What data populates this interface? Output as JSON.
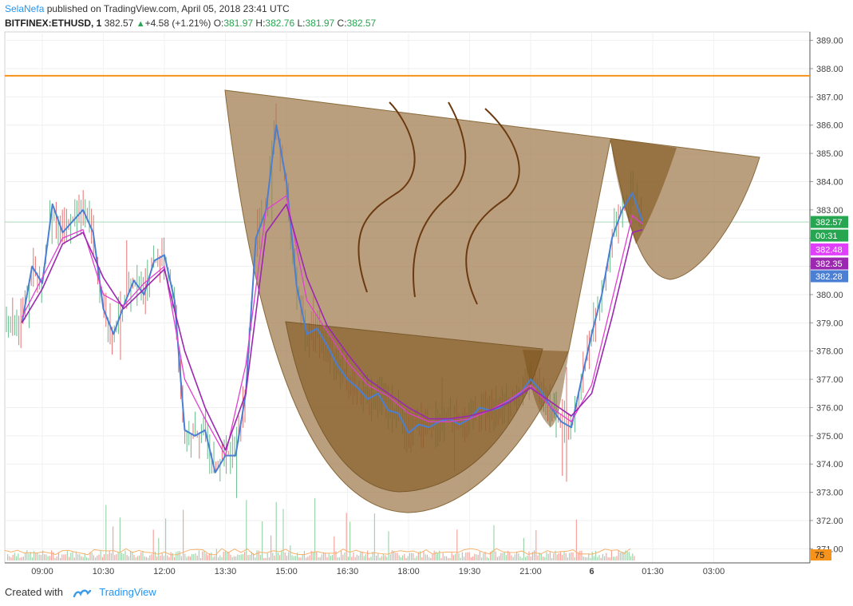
{
  "header": {
    "author": "SelaNefa",
    "published_text": "published on TradingView.com, April 05, 2018 23:41 UTC",
    "symbol": "BITFINEX:ETHUSD, 1",
    "last_price": "382.57",
    "change": "+4.58 (+1.21%)",
    "open_label": "O:",
    "open": "381.97",
    "high_label": "H:",
    "high": "382.76",
    "low_label": "L:",
    "low": "381.97",
    "close_label": "C:",
    "close": "382.57"
  },
  "footer": {
    "created_with": "Created with",
    "brand": "TradingView"
  },
  "colors": {
    "up": "#26a650",
    "down": "#ef5350",
    "cup_fill": "#a07a4e",
    "cup_dark": "#7a4e14",
    "orange_line": "#f7931a",
    "ema_blue": "#4a7fd4",
    "ema_magenta": "#e040d0",
    "ema_purple": "#9c27b0",
    "steam": "#6b3a10"
  },
  "chart_data": {
    "type": "line",
    "ylim": [
      370.5,
      389.3
    ],
    "y_ticks": [
      "389.00",
      "388.00",
      "387.00",
      "386.00",
      "385.00",
      "384.00",
      "383.00",
      "382.00",
      "381.00",
      "380.00",
      "379.00",
      "378.00",
      "377.00",
      "376.00",
      "375.00",
      "374.00",
      "373.00",
      "372.00",
      "371.00"
    ],
    "x_ticks": [
      "09:00",
      "10:30",
      "12:00",
      "13:30",
      "15:00",
      "16:30",
      "18:00",
      "19:30",
      "21:00",
      "6",
      "01:30",
      "03:00"
    ],
    "price_labels": [
      {
        "text": "382.57",
        "value": 382.57,
        "color": "#26a650"
      },
      {
        "text": "00:31",
        "value": 382.09,
        "color": "#26a650"
      },
      {
        "text": "382.48",
        "value": 381.6,
        "color": "#e040fb"
      },
      {
        "text": "382.35",
        "value": 381.1,
        "color": "#9c27b0"
      },
      {
        "text": "382.28",
        "value": 380.65,
        "color": "#4a7fd4"
      }
    ],
    "volume_label": {
      "text": "75",
      "color": "#f7931a"
    },
    "resistance_level": 387.75,
    "series": [
      {
        "x": [
          "08:30",
          "08:45",
          "09:00",
          "09:15",
          "09:30",
          "09:45",
          "10:00",
          "10:15",
          "10:30",
          "10:45",
          "11:00",
          "11:15",
          "11:30",
          "11:45",
          "12:00",
          "12:15",
          "12:30",
          "12:45",
          "13:00",
          "13:15",
          "13:30",
          "13:45",
          "14:00",
          "14:15",
          "14:30",
          "14:45",
          "15:00",
          "15:15",
          "15:30",
          "15:45",
          "16:00",
          "16:15",
          "16:30",
          "16:45",
          "17:00",
          "17:15",
          "17:30",
          "17:45",
          "18:00",
          "18:15",
          "18:30",
          "18:45",
          "19:00",
          "19:15",
          "19:30",
          "19:45",
          "20:00",
          "20:15",
          "20:30",
          "20:45",
          "21:00",
          "21:15",
          "21:30",
          "21:45",
          "22:00",
          "22:15",
          "22:30",
          "22:45",
          "23:00",
          "23:15",
          "23:30",
          "23:45"
        ],
        "values": [
          379.0,
          381.0,
          380.4,
          383.2,
          382.2,
          382.6,
          383.0,
          382.2,
          379.5,
          378.6,
          379.6,
          380.5,
          380.0,
          381.2,
          381.4,
          379.8,
          375.2,
          375.0,
          375.2,
          373.7,
          374.3,
          374.3,
          376.5,
          382.0,
          383.0,
          386.0,
          384.0,
          380.3,
          378.6,
          378.8,
          378.2,
          377.5,
          377.0,
          376.7,
          376.3,
          376.5,
          375.9,
          375.8,
          375.1,
          375.4,
          375.3,
          375.5,
          375.6,
          375.4,
          375.6,
          376.0,
          375.9,
          376.0,
          376.3,
          376.5,
          377.0,
          376.6,
          376.0,
          375.5,
          375.3,
          377.0,
          378.6,
          380.0,
          382.0,
          383.0,
          383.6,
          382.6
        ]
      },
      {
        "x": [
          "08:30",
          "09:00",
          "09:30",
          "10:00",
          "10:30",
          "11:00",
          "11:30",
          "12:00",
          "12:30",
          "13:00",
          "13:30",
          "14:00",
          "14:30",
          "15:00",
          "15:30",
          "16:00",
          "16:30",
          "17:00",
          "17:30",
          "18:00",
          "18:30",
          "19:00",
          "19:30",
          "20:00",
          "20:30",
          "21:00",
          "21:30",
          "22:00",
          "22:30",
          "23:00",
          "23:30",
          "23:45"
        ],
        "values": [
          379.2,
          380.6,
          382.0,
          382.3,
          380.0,
          379.6,
          380.4,
          381.0,
          377.0,
          375.6,
          374.3,
          377.5,
          383.0,
          383.5,
          379.8,
          378.7,
          377.6,
          376.8,
          376.4,
          375.8,
          375.5,
          375.5,
          375.6,
          375.9,
          376.3,
          376.8,
          376.0,
          375.5,
          376.8,
          379.8,
          382.8,
          382.5
        ]
      },
      {
        "x": [
          "08:30",
          "09:00",
          "09:30",
          "10:00",
          "10:30",
          "11:00",
          "11:30",
          "12:00",
          "12:30",
          "13:00",
          "13:30",
          "14:00",
          "14:30",
          "15:00",
          "15:30",
          "16:00",
          "16:30",
          "17:00",
          "17:30",
          "18:00",
          "18:30",
          "19:00",
          "19:30",
          "20:00",
          "20:30",
          "21:00",
          "21:30",
          "22:00",
          "22:30",
          "23:00",
          "23:30",
          "23:45"
        ],
        "values": [
          379.0,
          380.2,
          381.8,
          382.2,
          380.6,
          379.5,
          380.2,
          380.9,
          378.0,
          376.0,
          374.5,
          376.5,
          382.2,
          383.2,
          380.6,
          378.9,
          377.9,
          377.0,
          376.5,
          376.0,
          375.6,
          375.6,
          375.7,
          375.9,
          376.2,
          376.7,
          376.2,
          375.7,
          376.5,
          379.2,
          382.2,
          382.3
        ]
      }
    ]
  }
}
